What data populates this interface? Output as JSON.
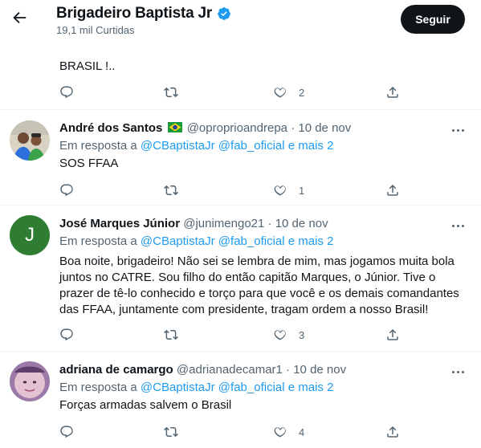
{
  "header": {
    "name": "Brigadeiro Baptista Jr",
    "likes_count": "19,1 mil Curtidas",
    "follow_label": "Seguir"
  },
  "top_tweet": {
    "text": "BRASIL !..",
    "like_count": "2"
  },
  "tweets": [
    {
      "display_name": "André dos Santos",
      "handle": "@oproprioandrepa",
      "date": "10 de nov",
      "reply_prefix": "Em resposta a",
      "reply_to": "@CBaptistaJr @fab_oficial e mais 2",
      "text": "SOS FFAA",
      "like_count": "1"
    },
    {
      "display_name": "José Marques Júnior",
      "handle": "@junimengo21",
      "date": "10 de nov",
      "reply_prefix": "Em resposta a",
      "reply_to": "@CBaptistaJr @fab_oficial e mais 2",
      "avatar_letter": "J",
      "text_lines": [
        "Boa noite, brigadeiro! Não sei se lembra de mim, mas jogamos muita bola",
        "juntos no CATRE. Sou filho do então capitão Marques, o Júnior.  Tive o",
        "prazer de tê-lo conhecido e torço para que você e os demais comandantes",
        "das FFAA, juntamente com presidente, tragam ordem a nosso Brasil!"
      ],
      "like_count": "3"
    },
    {
      "display_name": "adriana de camargo",
      "handle": "@adrianadecamar1",
      "date": "10 de nov",
      "reply_prefix": "Em resposta a",
      "reply_to": "@CBaptistaJr @fab_oficial e mais 2",
      "text": "Forças armadas salvem o Brasil",
      "like_count": "4"
    }
  ],
  "colors": {
    "accent": "#1d9bf0",
    "text_primary": "#0f1419",
    "text_secondary": "#536471",
    "avatar_green": "#2e7d32"
  }
}
